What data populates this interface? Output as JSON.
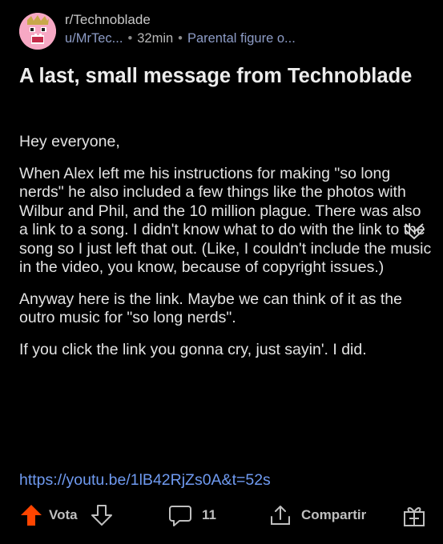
{
  "post": {
    "subreddit": "r/Technoblade",
    "author": "u/MrTec...",
    "time": "32min",
    "flair": "Parental figure o...",
    "title": "A last, small message from Technoblade",
    "paragraphs": [
      "Hey everyone,",
      "When Alex left me his instructions for making \"so long nerds\" he also included a few things like the photos with Wilbur and Phil, and the 10 million plague. There was also a link to a song. I didn't know what to do with the link to the song so I just left that out. (Like, I couldn't include the music in the video, you know, because of copyright issues.)",
      "Anyway here is the link. Maybe we can think of it as the outro music for \"so long nerds\".",
      "If you click the link you gonna cry, just sayin'. I did."
    ],
    "link": "https://youtu.be/1lB42RjZs0A&t=52s"
  },
  "actions": {
    "vote_label": "Vota",
    "comment_count": "11",
    "share_label": "Compartir"
  },
  "colors": {
    "background": "#000000",
    "upvote": "#ff4500",
    "link": "#6f9af0",
    "avatar": "#f7a8c4"
  },
  "icons": [
    "avatar-icon",
    "collapse-chevron-icon",
    "upvote-arrow-icon",
    "downvote-arrow-icon",
    "comment-bubble-icon",
    "share-icon",
    "gift-icon"
  ]
}
